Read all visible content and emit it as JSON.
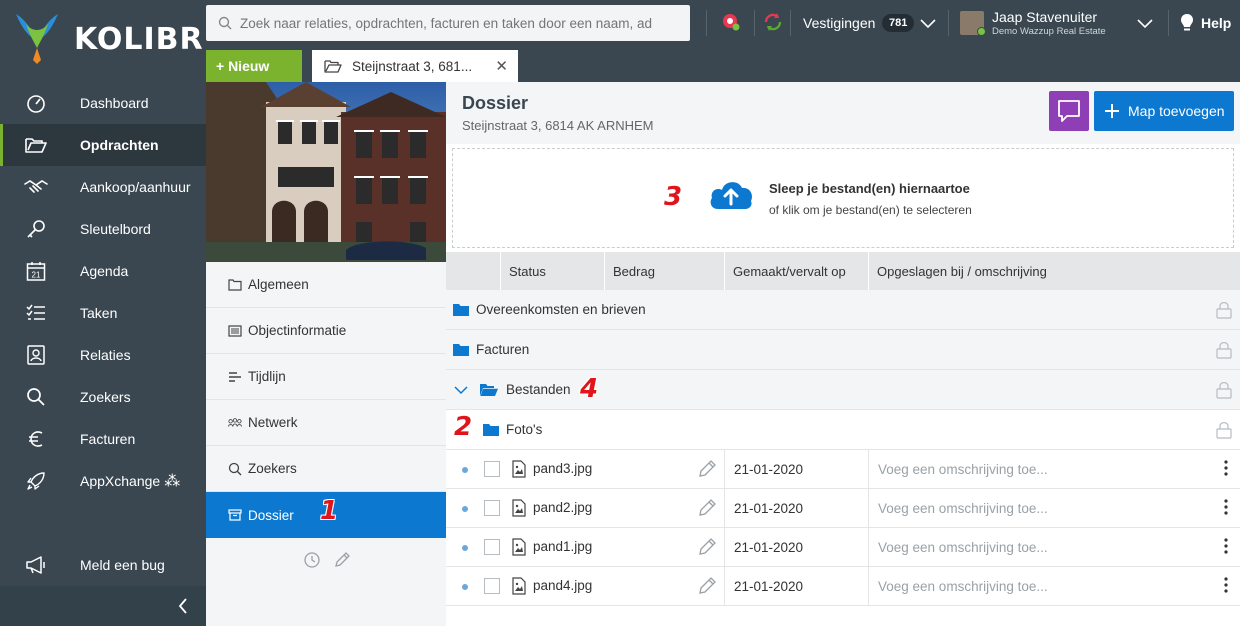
{
  "app": {
    "name": "KOLIBRI"
  },
  "nav": {
    "items": [
      {
        "label": "Dashboard",
        "icon": "dashboard-icon"
      },
      {
        "label": "Opdrachten",
        "icon": "folder-open-icon",
        "active": true
      },
      {
        "label": "Aankoop/aanhuur",
        "icon": "handshake-icon"
      },
      {
        "label": "Sleutelbord",
        "icon": "key-icon"
      },
      {
        "label": "Agenda",
        "icon": "calendar-icon",
        "badge": "21"
      },
      {
        "label": "Taken",
        "icon": "tasks-icon"
      },
      {
        "label": "Relaties",
        "icon": "contact-icon"
      },
      {
        "label": "Zoekers",
        "icon": "search-icon"
      },
      {
        "label": "Facturen",
        "icon": "euro-icon"
      },
      {
        "label": "AppXchange",
        "icon": "rocket-icon"
      }
    ],
    "bug_label": "Meld een bug"
  },
  "topbar": {
    "search_placeholder": "Zoek naar relaties, opdrachten, facturen en taken door een naam, ad",
    "vestigingen_label": "Vestigingen",
    "vestigingen_count": "781",
    "user_name": "Jaap Stavenuiter",
    "user_company": "Demo Wazzup Real Estate",
    "help_label": "Help"
  },
  "tabs": {
    "new_label": "+ Nieuw",
    "open_tab_label": "Steijnstraat 3, 681..."
  },
  "subnav": {
    "items": [
      {
        "label": "Algemeen",
        "icon": "folder-icon"
      },
      {
        "label": "Objectinformatie",
        "icon": "list-icon"
      },
      {
        "label": "Tijdlijn",
        "icon": "timeline-icon"
      },
      {
        "label": "Netwerk",
        "icon": "network-icon"
      },
      {
        "label": "Zoekers",
        "icon": "search-icon"
      },
      {
        "label": "Dossier",
        "icon": "archive-icon",
        "active": true
      }
    ]
  },
  "main": {
    "title": "Dossier",
    "subtitle": "Steijnstraat 3, 6814 AK ARNHEM",
    "add_folder_label": "Map toevoegen",
    "dropzone_title": "Sleep je bestand(en) hiernaartoe",
    "dropzone_sub": "of klik om je bestand(en) te selecteren",
    "columns": [
      "Status",
      "Bedrag",
      "Gemaakt/vervalt op",
      "Opgeslagen bij / omschrijving"
    ],
    "folders": [
      {
        "name": "Overeenkomsten en brieven"
      },
      {
        "name": "Facturen"
      },
      {
        "name": "Bestanden",
        "expanded": true
      },
      {
        "name": "Foto's"
      }
    ],
    "files": [
      {
        "name": "pand3.jpg",
        "date": "21-01-2020",
        "desc": "Voeg een omschrijving toe..."
      },
      {
        "name": "pand2.jpg",
        "date": "21-01-2020",
        "desc": "Voeg een omschrijving toe..."
      },
      {
        "name": "pand1.jpg",
        "date": "21-01-2020",
        "desc": "Voeg een omschrijving toe..."
      },
      {
        "name": "pand4.jpg",
        "date": "21-01-2020",
        "desc": "Voeg een omschrijving toe..."
      }
    ]
  },
  "annotations": [
    "1",
    "2",
    "3",
    "4"
  ],
  "colors": {
    "sidebar": "#3a4750",
    "accent_green": "#7bb32e",
    "accent_blue": "#0c78d0",
    "chat_purple": "#8e3fb5",
    "annotation_red": "#e0141a"
  }
}
